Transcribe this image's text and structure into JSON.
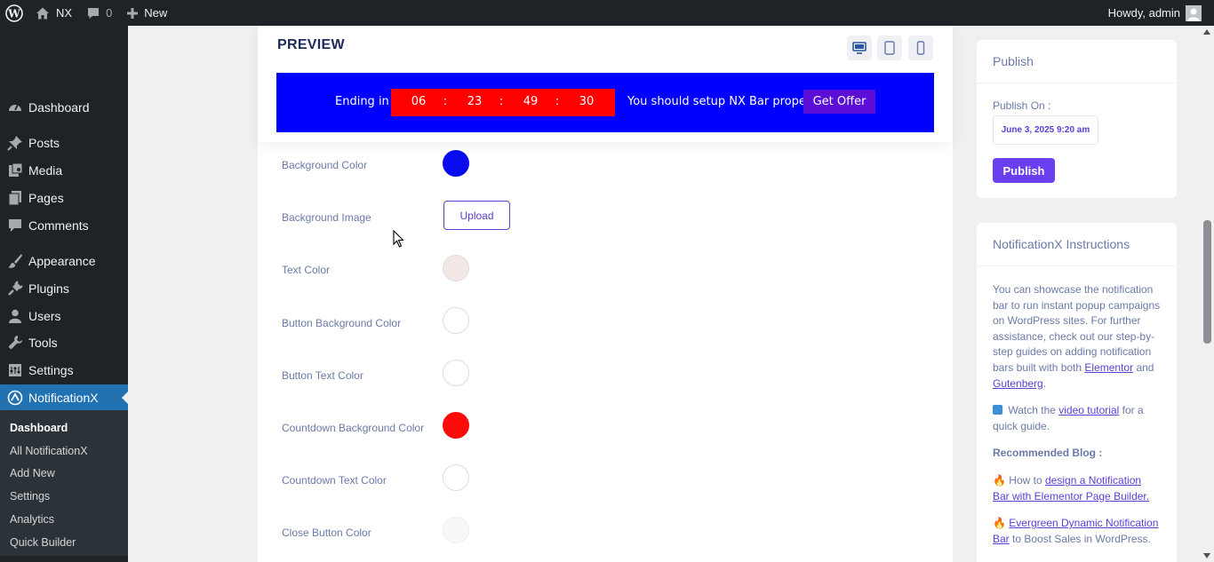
{
  "adminbar": {
    "site_name": "NX",
    "comments_count": "0",
    "new_label": "New",
    "howdy": "Howdy, admin"
  },
  "sidebar": {
    "items": [
      {
        "label": "Dashboard",
        "icon": "dashboard-icon"
      },
      {
        "label": "Posts",
        "icon": "pin-icon"
      },
      {
        "label": "Media",
        "icon": "media-icon"
      },
      {
        "label": "Pages",
        "icon": "pages-icon"
      },
      {
        "label": "Comments",
        "icon": "comment-icon"
      },
      {
        "label": "Appearance",
        "icon": "paintbrush-icon"
      },
      {
        "label": "Plugins",
        "icon": "plug-icon"
      },
      {
        "label": "Users",
        "icon": "users-icon"
      },
      {
        "label": "Tools",
        "icon": "wrench-icon"
      },
      {
        "label": "Settings",
        "icon": "settings-icon"
      },
      {
        "label": "NotificationX",
        "icon": "notificationx-icon"
      }
    ],
    "submenu": [
      "Dashboard",
      "All NotificationX",
      "Add New",
      "Settings",
      "Analytics",
      "Quick Builder"
    ]
  },
  "preview": {
    "title": "PREVIEW",
    "bar": {
      "ending_label": "Ending in",
      "countdown": [
        "06",
        "23",
        "49",
        "30"
      ],
      "separator": ":",
      "message": "You should setup NX Bar properly",
      "button": "Get Offer",
      "background_color": "#0000ff",
      "countdown_color": "#ff0000",
      "button_color": "#5b0fd6"
    }
  },
  "settings": [
    {
      "label": "Background Color",
      "color": "#0a0aee"
    },
    {
      "label": "Background Image",
      "button": "Upload"
    },
    {
      "label": "Text Color",
      "color": "#f3e8e6"
    },
    {
      "label": "Button Background Color",
      "color": "#ffffff"
    },
    {
      "label": "Button Text Color",
      "color": "#ffffff"
    },
    {
      "label": "Countdown Background Color",
      "color": "#ff0a0a"
    },
    {
      "label": "Countdown Text Color",
      "color": "#ffffff"
    },
    {
      "label": "Close Button Color",
      "color": "#f8f8f8"
    }
  ],
  "publish": {
    "title": "Publish",
    "publish_on_label": "Publish On :",
    "date": "June 3, 2025 9:20 am",
    "button": "Publish"
  },
  "instructions": {
    "title": "NotificationX Instructions",
    "intro": "You can showcase the notification bar to run instant popup campaigns on WordPress sites. For further assistance, check out our step-by-step guides on adding notification bars built with both",
    "elementor": "Elementor",
    "and": "and",
    "gutenberg": "Gutenberg",
    "period": ".",
    "watch_prefix": "Watch the",
    "video_link": "video tutorial",
    "watch_suffix": "for a quick guide.",
    "recommended": "Recommended Blog :",
    "blog1_prefix": "How to",
    "blog1_link": "design a Notification Bar with Elementor Page Builder.",
    "blog2_link": "Evergreen Dynamic Notification Bar",
    "blog2_suffix": "to Boost Sales in WordPress."
  }
}
